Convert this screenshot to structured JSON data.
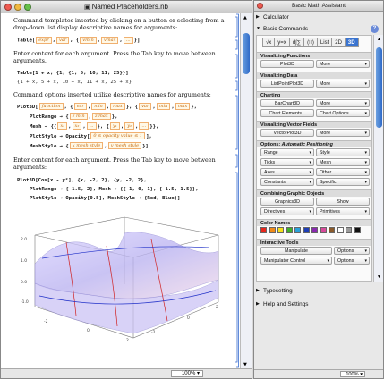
{
  "notebook": {
    "title": "Named Placeholders.nb",
    "para1": "Command templates inserted by clicking on a button or selecting from a drop-down list display descriptive names for arguments:",
    "table_template": {
      "head": "Table[",
      "ph1": "expr",
      "sep1": ",",
      "ph2": "var",
      "sep2": ", {",
      "ph3": "vmin",
      "sep3": ",",
      "ph4": "vmax",
      "sep4": ",",
      "ph5": "...",
      "tail": "}]"
    },
    "para2": "Enter content for each argument. Press the Tab key to move between arguments.",
    "table_input": "Table[1 + x, {1, {1, 5, 10, 11, 25}}]",
    "table_output": "{1 + x, 5 + x, 10 + x, 11 + x, 25 + x}",
    "para3": "Command options inserted utilize descriptive names for arguments:",
    "plot3d_template": {
      "head": "Plot3D[",
      "ph1": "function",
      "ph2": "var",
      "ph3": "min",
      "ph4": "max",
      "ph5": "var",
      "ph6": "min",
      "ph7": "max",
      "plotrange": "PlotRange → {",
      "pr1": "z min",
      "pr2": "z max",
      "mesh": "Mesh → {{",
      "m1": "x₁",
      "m2": "x₂",
      "m3": "...",
      "m4": "y₁",
      "m5": "y₂",
      "m6": "...",
      "plotstyle": "PlotStyle → Opacity[",
      "ps1": "0 ≤ opacity value ≤ 1",
      "meshstyle": "MeshStyle → {",
      "ms1": "x mesh style",
      "ms2": "y mesh style"
    },
    "para4": "Enter content for each argument. Press the Tab key to move between arguments:",
    "plot_input_1": "Plot3D[Cos[x - y²], {x, -2, 2}, {y, -2, 2},",
    "plot_input_2": "PlotRange → {-1.5, 2}, Mesh → {{-1, 0, 1}, {-1.5, 1.5}},",
    "plot_input_3": "PlotStyle → Opacity[0.5], MeshStyle → {Red, Blue}]",
    "zoom": "100%"
  },
  "palette": {
    "title": "Basic Math Assistant",
    "calculator": "Calculator",
    "basic_commands": "Basic Commands",
    "tabs": [
      "√x",
      "y=x",
      "d∫∑",
      "(∷)",
      "List",
      "2D",
      "3D"
    ],
    "sections": [
      {
        "header": "Visualizing Functions",
        "rows": [
          [
            "Plot3D",
            "More"
          ]
        ]
      },
      {
        "header": "Visualizing Data",
        "rows": [
          [
            "ListPointPlot3D",
            "More"
          ]
        ]
      },
      {
        "header": "Charting",
        "rows": [
          [
            "BarChart3D",
            "More"
          ],
          [
            "Chart Elements...",
            "Chart Options"
          ]
        ]
      },
      {
        "header": "Visualizing Vector Fields",
        "rows": [
          [
            "VectorPlot3D",
            "More"
          ]
        ]
      }
    ],
    "options_header": "Options: ",
    "options_header_em": "Automatic Positioning",
    "option_rows": [
      [
        "Range",
        "Style"
      ],
      [
        "Ticks",
        "Mesh"
      ],
      [
        "Axes",
        "Other"
      ],
      [
        "Constants",
        "Specific"
      ]
    ],
    "combining_header": "Combining Graphic Objects",
    "combining_rows": [
      [
        "Graphics3D",
        "Show"
      ],
      [
        "Directives",
        "Primitives"
      ]
    ],
    "color_header": "Color Names",
    "colors": [
      "#e8261c",
      "#f08a18",
      "#f5e11a",
      "#40b02a",
      "#2aa0d8",
      "#1e3fb8",
      "#8a2ab0",
      "#d84a9a",
      "#8a5a2a",
      "#ffffff",
      "#9a9a9a",
      "#111111"
    ],
    "interactive_header": "Interactive Tools",
    "interactive_rows": [
      [
        "Manipulate",
        "Options"
      ],
      [
        "Manipulator Control",
        "Options"
      ]
    ],
    "typesetting": "Typesetting",
    "help": "Help and Settings",
    "zoom": "100%"
  },
  "colors": {
    "accent": "#3a74d0",
    "placeholder_border": "#f0b070",
    "placeholder_text": "#c46a10"
  }
}
